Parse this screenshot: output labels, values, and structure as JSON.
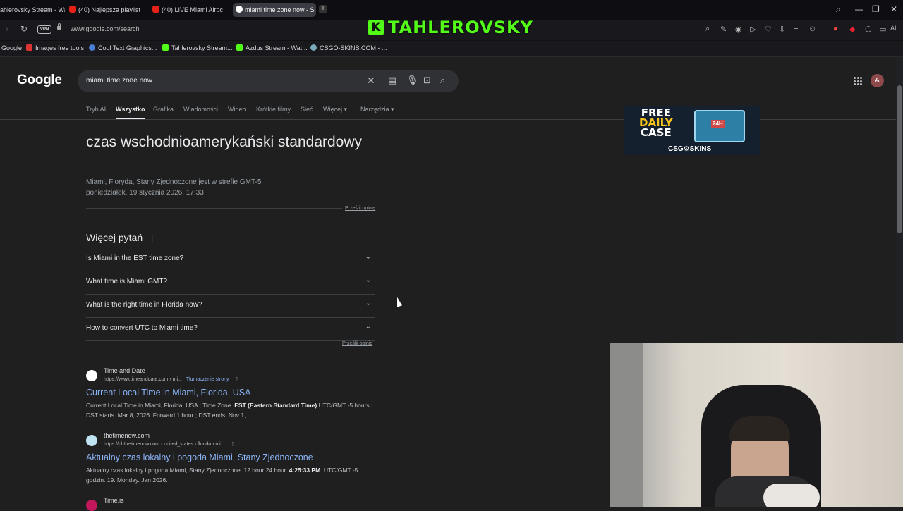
{
  "browser": {
    "tabs": [
      {
        "label": "ahlerovsky Stream - Wat",
        "icon": "stream-icon"
      },
      {
        "label": "(40) Najlepsza playlist",
        "icon": "youtube-icon"
      },
      {
        "label": "(40) LIVE Miami Airpc",
        "icon": "youtube-icon"
      },
      {
        "label": "miami time zone now - S",
        "icon": "google-icon"
      }
    ],
    "new_tab": "+",
    "url": "www.google.com/search",
    "vpn_label": "VPN",
    "overlay_logo_letter": "K",
    "overlay_text": "TAHLEROVSKY",
    "ai_label": "AI",
    "bookmarks": [
      {
        "label": "Google"
      },
      {
        "label": "Images free tools"
      },
      {
        "label": "Cool Text Graphics..."
      },
      {
        "label": "Tahlerovsky Stream..."
      },
      {
        "label": "Azdus Stream - Wat..."
      },
      {
        "label": "CSGO-SKINS.COM - ..."
      }
    ]
  },
  "google": {
    "logo": "Google",
    "query": "miami time zone now",
    "avatar_letter": "A",
    "tabs": [
      "Tryb AI",
      "Wszystko",
      "Grafika",
      "Wiadomości",
      "Wideo",
      "Krótkie filmy",
      "Sieć",
      "Więcej",
      "Narzędzia"
    ],
    "active_tab": "Wszystko",
    "timezone": {
      "title": "czas wschodnioamerykański standardowy",
      "location": "Miami, Floryda, Stany Zjednoczone jest w strefie GMT-5",
      "datetime": "poniedziałek, 19 stycznia 2026, 17:33",
      "feedback": "Prześlij opinię"
    },
    "more_questions": {
      "heading": "Więcej pytań",
      "items": [
        "Is Miami in the EST time zone?",
        "What time is Miami GMT?",
        "What is the right time in Florida now?",
        "How to convert UTC to Miami time?"
      ],
      "feedback": "Prześlij opinię"
    },
    "results": [
      {
        "site": "Time and Date",
        "url": "https://www.timeanddate.com › mi...",
        "translate": "Tłumaczenie strony",
        "title": "Current Local Time in Miami, Florida, USA",
        "snippet_1": "Current Local Time in Miami, Florida, USA ; Time Zone. ",
        "snippet_bold": "EST (Eastern Standard Time)",
        "snippet_2": " UTC/GMT -5 hours ; DST starts. Mar 8, 2026. Forward 1 hour ; DST ends. Nov 1, ..."
      },
      {
        "site": "thetimenow.com",
        "url": "https://pl.thetimenow.com › united_states › florida › mi...",
        "title": "Aktualny czas lokalny i pogoda Miami, Stany Zjednoczone",
        "snippet_1": "Aktualny czas lokalny i pogoda Miami, Stany Zjednoczone. 12 hour 24 hour. ",
        "snippet_bold": "4:25:33 PM",
        "snippet_2": ". UTC/GMT -5 godzin. 19. Monday. Jan 2026."
      },
      {
        "site": "Time.is"
      }
    ],
    "ad": {
      "line1": "FREE",
      "line2": "DAILY",
      "line3": "CASE",
      "brand": "CSG⚙SKINS"
    }
  }
}
